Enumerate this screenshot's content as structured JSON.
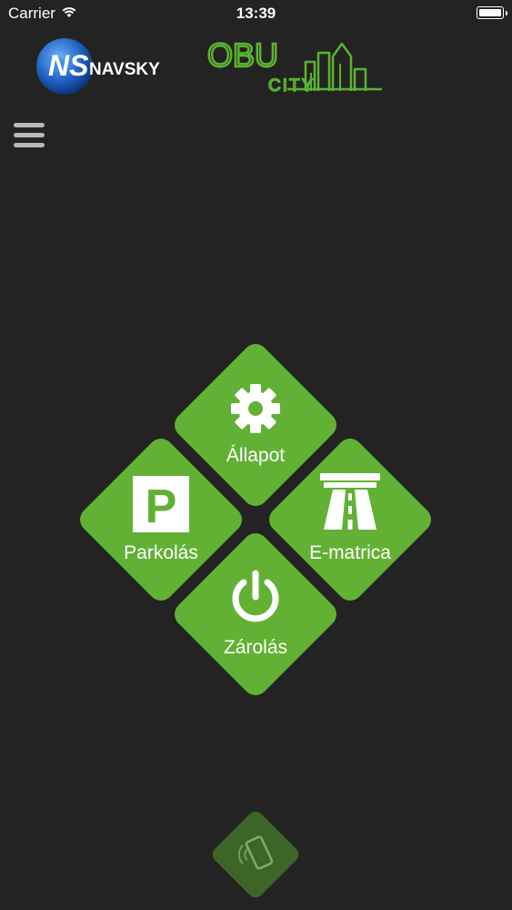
{
  "status_bar": {
    "carrier": "Carrier",
    "time": "13:39",
    "battery_level": 1.0
  },
  "logos": {
    "ns_initials": "NS",
    "ns_name": "NAVSKY",
    "obu_title": "OBU",
    "obu_subtitle": "CITY"
  },
  "tiles": {
    "allapot": {
      "label": "Állapot",
      "icon": "gear-icon"
    },
    "parkolas": {
      "label": "Parkolás",
      "icon": "parking-icon"
    },
    "ematrica": {
      "label": "E-matrica",
      "icon": "highway-icon"
    },
    "zarolas": {
      "label": "Zárolás",
      "icon": "power-icon"
    }
  },
  "nfc_button": {
    "icon": "phone-nfc-icon"
  },
  "colors": {
    "accent": "#62b135",
    "background": "#232323",
    "nfc_tile": "#3d6527",
    "obu_green": "#5cb330"
  }
}
